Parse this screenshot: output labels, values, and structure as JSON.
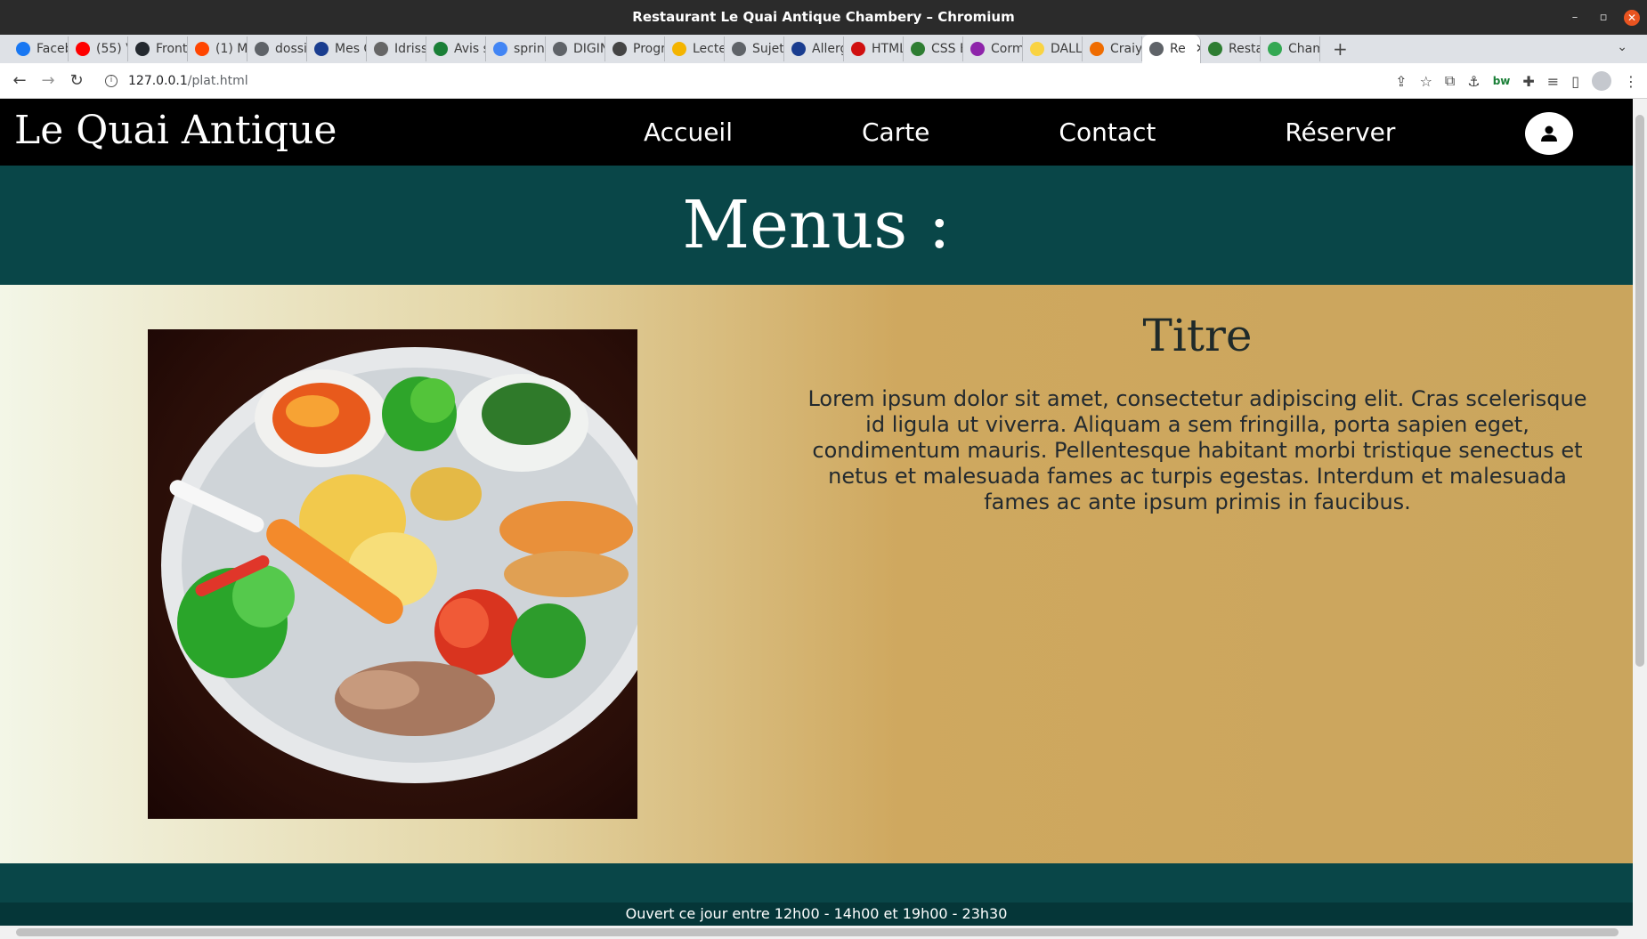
{
  "window": {
    "title": "Restaurant Le Quai Antique Chambery – Chromium",
    "minimize": "–",
    "restore": "▫",
    "close": "✕"
  },
  "tabs": [
    {
      "label": "Faceb",
      "color": "#1877f2"
    },
    {
      "label": "(55) V",
      "color": "#ff0000"
    },
    {
      "label": "Front",
      "color": "#24292f"
    },
    {
      "label": "(1) M",
      "color": "#ff4500"
    },
    {
      "label": "dossi",
      "color": "#5f6368"
    },
    {
      "label": "Mes C",
      "color": "#1a3d8f"
    },
    {
      "label": "Idriss",
      "color": "#666666"
    },
    {
      "label": "Avis s",
      "color": "#1a7f37"
    },
    {
      "label": "sprin",
      "color": "#4285f4"
    },
    {
      "label": "DIGIN",
      "color": "#5f6368"
    },
    {
      "label": "Progr",
      "color": "#444444"
    },
    {
      "label": "Lecte",
      "color": "#f4b400"
    },
    {
      "label": "Sujet",
      "color": "#5f6368"
    },
    {
      "label": "Allerg",
      "color": "#1a3d8f"
    },
    {
      "label": "HTML",
      "color": "#d01010"
    },
    {
      "label": "CSS B",
      "color": "#2e7d32"
    },
    {
      "label": "Corm",
      "color": "#8e24aa"
    },
    {
      "label": "DALL",
      "color": "#f9d342"
    },
    {
      "label": "Craiy",
      "color": "#ef6c00"
    },
    {
      "label": "Re",
      "color": "#5f6368",
      "active": true
    },
    {
      "label": "Resta",
      "color": "#2e7d32"
    },
    {
      "label": "Cham",
      "color": "#34a853"
    }
  ],
  "tab_bar": {
    "new_tab": "+",
    "tab_menu": "⌄",
    "close": "✕"
  },
  "address": {
    "host": "127.0.0.1",
    "path": "/plat.html",
    "info": "i"
  },
  "toolbar_icons": [
    "share-icon",
    "star-icon",
    "extension-icon",
    "pin-icon",
    "bw-icon",
    "puzzle-icon",
    "media-icon",
    "sidepanel-icon",
    "profile-icon",
    "menu-icon"
  ],
  "site": {
    "logo": "Le Quai Antique",
    "nav": [
      "Accueil",
      "Carte",
      "Contact",
      "Réserver"
    ],
    "section_title": "Menus :",
    "dish_title": "Titre",
    "dish_text": "Lorem ipsum dolor sit amet, consectetur adipiscing elit. Cras scelerisque id ligula ut viverra. Aliquam a sem fringilla, porta sapien eget, condimentum mauris. Pellentesque habitant morbi tristique senectus et netus et malesuada fames ac turpis egestas. Interdum et malesuada fames ac ante ipsum primis in faucibus.",
    "footer_hours": "Ouvert ce jour entre 12h00 - 14h00 et 19h00 - 23h30"
  },
  "colors": {
    "nav_bg": "#000000",
    "band": "#094648",
    "gold": "#caa55d"
  }
}
